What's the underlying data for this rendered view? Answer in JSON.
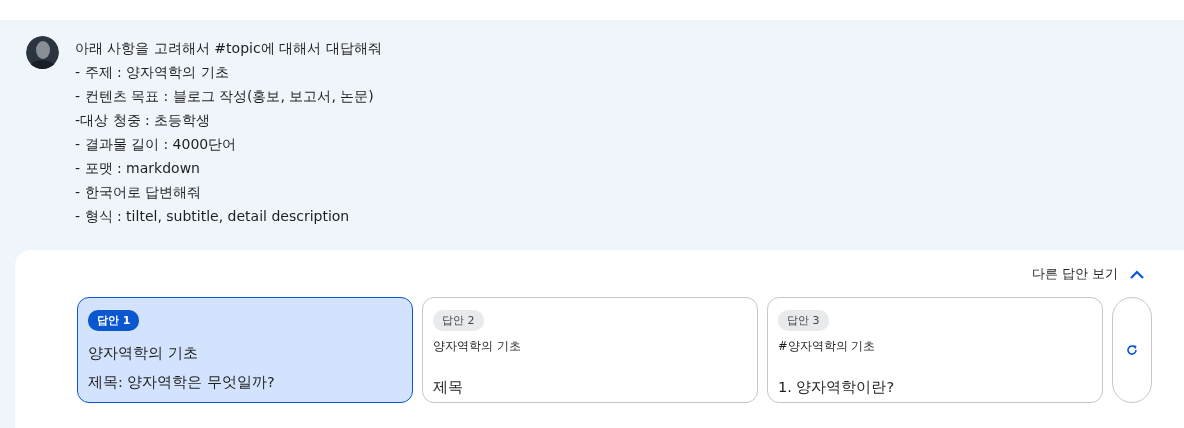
{
  "prompt": {
    "lines": [
      "아래 사항을 고려해서 #topic에 대해서 대답해줘",
      "- 주제 : 양자역학의 기초",
      "- 컨텐츠 목표 : 블로그 작성(홍보, 보고서, 논문)",
      "-대상 청중 : 초등학생",
      "- 결과물 길이 : 4000단어",
      "- 포맷 : markdown",
      "- 한국어로 답변해줘",
      "- 형식 : tiltel, subtitle, detail description"
    ]
  },
  "drafts_toggle": {
    "label": "다른 답안 보기",
    "expanded": true
  },
  "drafts": [
    {
      "label": "답안 1",
      "selected": true,
      "lines": [
        {
          "kind": "body",
          "text": "양자역학의 기초"
        },
        {
          "kind": "body",
          "text": "제목: 양자역학은 무엇일까?"
        }
      ]
    },
    {
      "label": "답안 2",
      "selected": false,
      "lines": [
        {
          "kind": "caption",
          "text": "양자역학의 기초"
        },
        {
          "kind": "body",
          "text": "제목"
        }
      ]
    },
    {
      "label": "답안 3",
      "selected": false,
      "lines": [
        {
          "kind": "caption",
          "text": "#양자역학의 기초"
        },
        {
          "kind": "body",
          "text": "1. 양자역학이란?"
        }
      ]
    }
  ]
}
